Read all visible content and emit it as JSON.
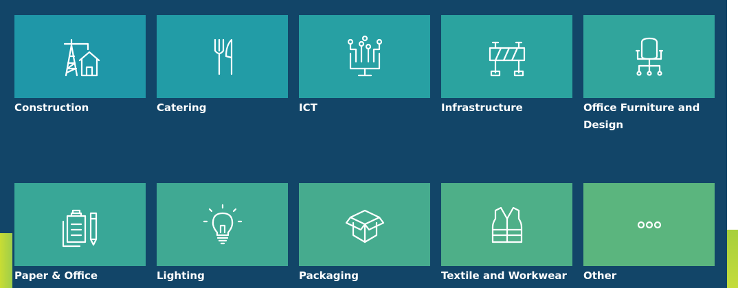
{
  "categories": [
    {
      "label": "Construction",
      "icon": "construction-icon",
      "color": "#1f97a8"
    },
    {
      "label": "Catering",
      "icon": "cutlery-icon",
      "color": "#229ca6"
    },
    {
      "label": "ICT",
      "icon": "computer-network-icon",
      "color": "#27a0a3"
    },
    {
      "label": "Infrastructure",
      "icon": "roadblock-icon",
      "color": "#2ba39f"
    },
    {
      "label": "Office Furniture and Design",
      "icon": "office-chair-icon",
      "color": "#31a59c"
    },
    {
      "label": "Paper & Office Supplies",
      "icon": "clipboard-pencil-icon",
      "color": "#39a797"
    },
    {
      "label": "Lighting",
      "icon": "light-bulb-icon",
      "color": "#40a993"
    },
    {
      "label": "Packaging",
      "icon": "box-icon",
      "color": "#46ab8e"
    },
    {
      "label": "Textile and Workwear",
      "icon": "safety-vest-icon",
      "color": "#4eaf88"
    },
    {
      "label": "Other",
      "icon": "more-icon",
      "color": "#5bb57e"
    }
  ]
}
